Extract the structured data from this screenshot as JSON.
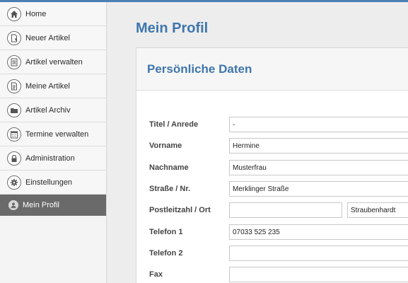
{
  "sidebar": {
    "items": [
      {
        "label": "Home",
        "icon": "home-icon"
      },
      {
        "label": "Neuer Artikel",
        "icon": "new-document-icon"
      },
      {
        "label": "Artikel verwalten",
        "icon": "document-list-icon"
      },
      {
        "label": "Meine Artikel",
        "icon": "document-icon"
      },
      {
        "label": "Artikel Archiv",
        "icon": "folder-icon"
      },
      {
        "label": "Termine verwalten",
        "icon": "calendar-icon"
      },
      {
        "label": "Administration",
        "icon": "lock-icon"
      },
      {
        "label": "Einstellungen",
        "icon": "gear-icon"
      },
      {
        "label": "Mein Profil",
        "icon": "user-icon",
        "active": true
      }
    ]
  },
  "main": {
    "title": "Mein Profil",
    "panel_title": "Persönliche Daten",
    "form": {
      "titel_label": "Titel / Anrede",
      "titel_value": "-",
      "vorname_label": "Vorname",
      "vorname_value": "Hermine",
      "nachname_label": "Nachname",
      "nachname_value": "Musterfrau",
      "strasse_label": "Straße / Nr.",
      "strasse_value": "Merklinger Straße",
      "plz_label": "Postleitzahl / Ort",
      "plz_value": "",
      "ort_value": "Straubenhardt",
      "telefon1_label": "Telefon 1",
      "telefon1_value": "07033 525 235",
      "telefon2_label": "Telefon 2",
      "telefon2_value": "",
      "fax_label": "Fax",
      "fax_value": ""
    }
  },
  "colors": {
    "accent": "#3f76ad",
    "active_nav": "#6a6a6a"
  }
}
